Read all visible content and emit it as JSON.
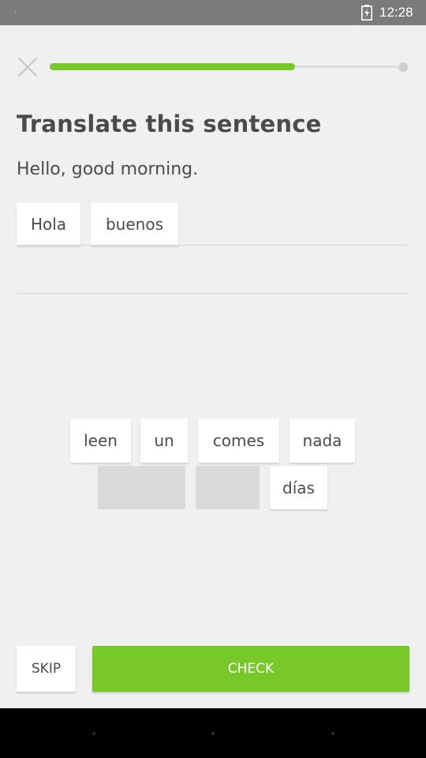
{
  "status_bar": {
    "time": "12:28",
    "battery_icon": "battery-charging-icon"
  },
  "header": {
    "close_icon": "close-icon",
    "progress_fraction": 0.69
  },
  "lesson": {
    "heading": "Translate this sentence",
    "prompt": "Hello, good morning.",
    "answer_words": [
      "Hola",
      "buenos"
    ],
    "word_bank_row1": [
      "leen",
      "un",
      "comes",
      "nada"
    ],
    "word_bank_row2": [
      "",
      "",
      "días"
    ]
  },
  "footer": {
    "skip_label": "SKIP",
    "check_label": "CHECK"
  },
  "colors": {
    "accent": "#78c82a",
    "background": "#f0f0f0",
    "text": "#4b4b4b"
  }
}
